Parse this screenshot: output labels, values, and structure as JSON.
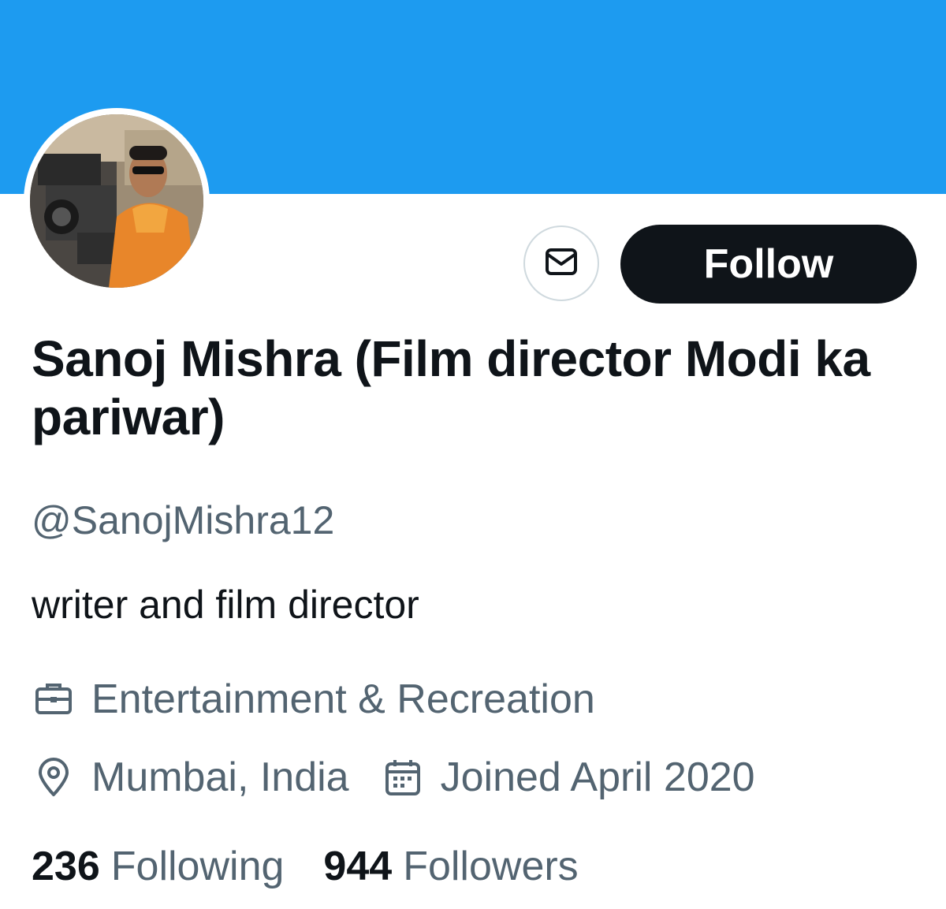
{
  "profile": {
    "display_name": "Sanoj Mishra (Film director Modi ka pariwar)",
    "handle": "@SanojMishra12",
    "bio": "writer and film director",
    "category": "Entertainment & Recreation",
    "location": "Mumbai, India",
    "joined": "Joined April 2020",
    "avatar_alt": "profile photo"
  },
  "actions": {
    "follow_label": "Follow",
    "message_icon": "envelope-icon"
  },
  "stats": {
    "following_count": "236",
    "following_label": "Following",
    "followers_count": "944",
    "followers_label": "Followers"
  },
  "colors": {
    "banner": "#1d9bf0",
    "primary_text": "#0f1419",
    "secondary_text": "#536471",
    "button_bg": "#0f1419"
  }
}
